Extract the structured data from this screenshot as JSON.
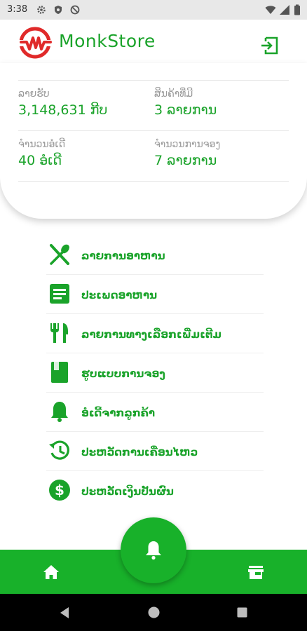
{
  "status_bar": {
    "time": "3:38",
    "icons": [
      "gear-icon",
      "shield-icon",
      "no-sync-icon"
    ],
    "right_icons": [
      "wifi-icon",
      "signal-icon",
      "battery-icon"
    ]
  },
  "header": {
    "brand": "MonkStore",
    "logo": "monkstore-logo",
    "action_icon": "logout-icon"
  },
  "stats": [
    {
      "label": "ລາຍຮັບ",
      "value": "3,148,631 ກີບ"
    },
    {
      "label": "ສິນຄ້າທີ່ມີ",
      "value": "3 ລາຍການ"
    },
    {
      "label": "ຈຳນວນອໍເດີ",
      "value": "40 ອໍເດີ"
    },
    {
      "label": "ຈຳນວນການຈອງ",
      "value": "7 ລາຍການ"
    }
  ],
  "menu": [
    {
      "label": "ລາຍການອາຫານ",
      "icon": "utensils-icon"
    },
    {
      "label": "ປະເພດອາຫານ",
      "icon": "document-icon"
    },
    {
      "label": "ລາຍການທາງເລືອກເພີ່ມເຕີມ",
      "icon": "fork-knife-icon"
    },
    {
      "label": "ຮູບແບບການຈອງ",
      "icon": "book-icon"
    },
    {
      "label": "ອໍເດີ້ຈາກລູກຄ້າ",
      "icon": "bell-icon"
    },
    {
      "label": "ປະຫວັດການເຄື່ອນໄຫວ",
      "icon": "history-icon"
    },
    {
      "label": "ປະຫວັດເງິນປັນຜົນ",
      "icon": "dollar-icon"
    }
  ],
  "bottom_nav": {
    "left": "home-icon",
    "center": "bell-icon",
    "right": "store-icon"
  },
  "colors": {
    "accent": "#1aa32a",
    "bar": "#18b12a",
    "logo_red": "#e02a2a"
  }
}
